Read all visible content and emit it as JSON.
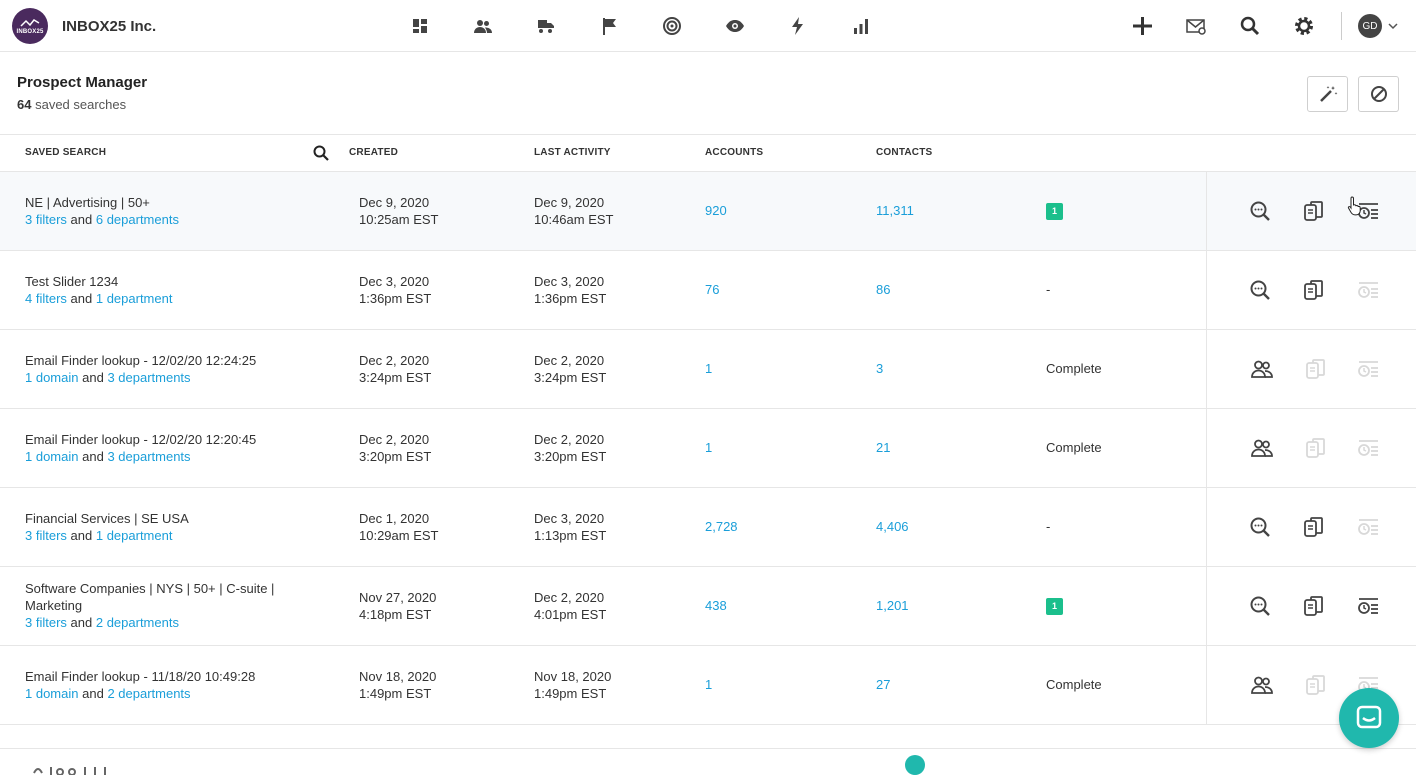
{
  "app": {
    "company": "INBOX25 Inc.",
    "logo_text": "INBOX25"
  },
  "nav_icons": [
    "dashboard-icon",
    "contacts-icon",
    "campaigns-icon",
    "flag-icon",
    "target-icon",
    "eye-icon",
    "bolt-icon",
    "reports-icon"
  ],
  "user": {
    "initials": "GD"
  },
  "header": {
    "title": "Prospect Manager",
    "count": "64",
    "count_label": "saved searches"
  },
  "columns": {
    "saved_search": "SAVED SEARCH",
    "created": "CREATED",
    "last_activity": "LAST ACTIVITY",
    "accounts": "ACCOUNTS",
    "contacts": "CONTACTS"
  },
  "rows": [
    {
      "name": "NE | Advertising | 50+",
      "a_link": "3 filters",
      "and": "and",
      "b_link": "6 departments",
      "created_date": "Dec 9, 2020",
      "created_time": "10:25am EST",
      "act_date": "Dec 9, 2020",
      "act_time": "10:46am EST",
      "accounts": "920",
      "contacts": "11,311",
      "status": "1",
      "status_type": "badge",
      "first_action": "search",
      "copy_active": true,
      "history_active": true
    },
    {
      "name": "Test Slider 1234",
      "a_link": "4 filters",
      "and": "and",
      "b_link": "1 department",
      "created_date": "Dec 3, 2020",
      "created_time": "1:36pm EST",
      "act_date": "Dec 3, 2020",
      "act_time": "1:36pm EST",
      "accounts": "76",
      "contacts": "86",
      "status": "-",
      "status_type": "text",
      "first_action": "search",
      "copy_active": true,
      "history_active": false
    },
    {
      "name": "Email Finder lookup - 12/02/20 12:24:25",
      "a_link": "1 domain",
      "and": "and",
      "b_link": "3 departments",
      "created_date": "Dec 2, 2020",
      "created_time": "3:24pm EST",
      "act_date": "Dec 2, 2020",
      "act_time": "3:24pm EST",
      "accounts": "1",
      "contacts": "3",
      "status": "Complete",
      "status_type": "text",
      "first_action": "people",
      "copy_active": false,
      "history_active": false
    },
    {
      "name": "Email Finder lookup - 12/02/20 12:20:45",
      "a_link": "1 domain",
      "and": "and",
      "b_link": "3 departments",
      "created_date": "Dec 2, 2020",
      "created_time": "3:20pm EST",
      "act_date": "Dec 2, 2020",
      "act_time": "3:20pm EST",
      "accounts": "1",
      "contacts": "21",
      "status": "Complete",
      "status_type": "text",
      "first_action": "people",
      "copy_active": false,
      "history_active": false
    },
    {
      "name": "Financial Services | SE USA",
      "a_link": "3 filters",
      "and": "and",
      "b_link": "1 department",
      "created_date": "Dec 1, 2020",
      "created_time": "10:29am EST",
      "act_date": "Dec 3, 2020",
      "act_time": "1:13pm EST",
      "accounts": "2,728",
      "contacts": "4,406",
      "status": "-",
      "status_type": "text",
      "first_action": "search",
      "copy_active": true,
      "history_active": false
    },
    {
      "name": "Software Companies | NYS | 50+ | C-suite | Marketing",
      "a_link": "3 filters",
      "and": "and",
      "b_link": "2 departments",
      "created_date": "Nov 27, 2020",
      "created_time": "4:18pm EST",
      "act_date": "Dec 2, 2020",
      "act_time": "4:01pm EST",
      "accounts": "438",
      "contacts": "1,201",
      "status": "1",
      "status_type": "badge",
      "first_action": "search",
      "copy_active": true,
      "history_active": true
    },
    {
      "name": "Email Finder lookup - 11/18/20 10:49:28",
      "a_link": "1 domain",
      "and": "and",
      "b_link": "2 departments",
      "created_date": "Nov 18, 2020",
      "created_time": "1:49pm EST",
      "act_date": "Nov 18, 2020",
      "act_time": "1:49pm EST",
      "accounts": "1",
      "contacts": "27",
      "status": "Complete",
      "status_type": "text",
      "first_action": "people",
      "copy_active": false,
      "history_active": false
    }
  ],
  "colors": {
    "link": "#1a9ed9",
    "badge": "#1bbf8c",
    "chat": "#20b8ad"
  }
}
